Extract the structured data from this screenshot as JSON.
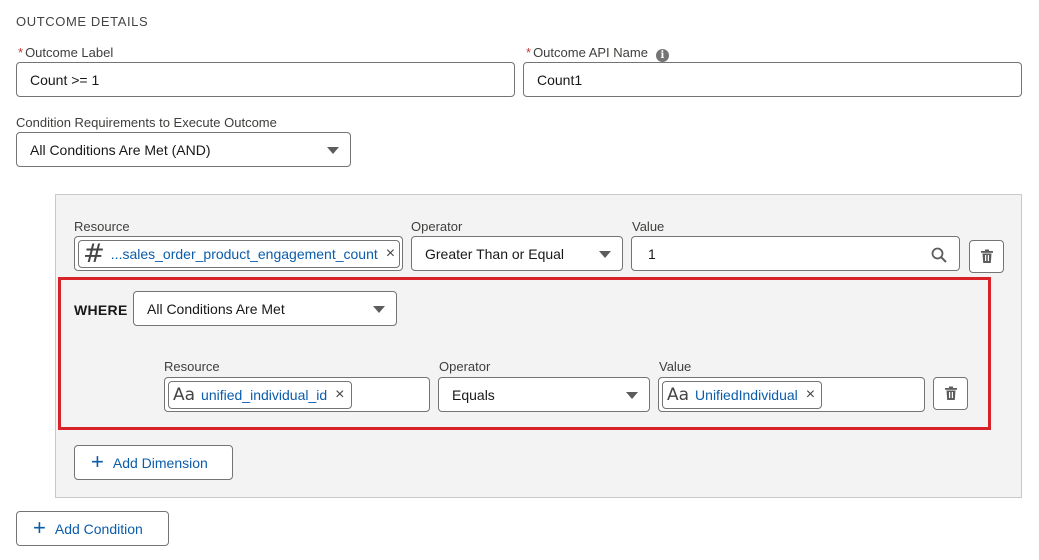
{
  "section": {
    "title": "OUTCOME DETAILS"
  },
  "outcome": {
    "label_caption": "Outcome Label",
    "label_value": "Count >= 1",
    "api_caption": "Outcome API Name",
    "api_value": "Count1",
    "required_mark": "*"
  },
  "condition_requirements": {
    "caption": "Condition Requirements to Execute Outcome",
    "value": "All Conditions Are Met (AND)"
  },
  "condition": {
    "resource_caption": "Resource",
    "operator_caption": "Operator",
    "value_caption": "Value",
    "resource_value": "...sales_order_product_engagement_count",
    "operator_value": "Greater Than or Equal",
    "value": "1"
  },
  "where": {
    "label": "WHERE",
    "logic_value": "All Conditions Are Met",
    "resource_caption": "Resource",
    "operator_caption": "Operator",
    "value_caption": "Value",
    "resource_value": "unified_individual_id",
    "operator_value": "Equals",
    "value": "UnifiedIndividual"
  },
  "buttons": {
    "add_dimension": "Add Dimension",
    "add_condition": "Add Condition"
  },
  "icons": {
    "number": "#",
    "text_type": "Aa",
    "close": "×",
    "info": "i",
    "plus": "+"
  },
  "colors": {
    "link": "#0b5cab",
    "required": "#c23934",
    "highlight": "#d62228",
    "panel_bg": "#f3f3f3"
  }
}
